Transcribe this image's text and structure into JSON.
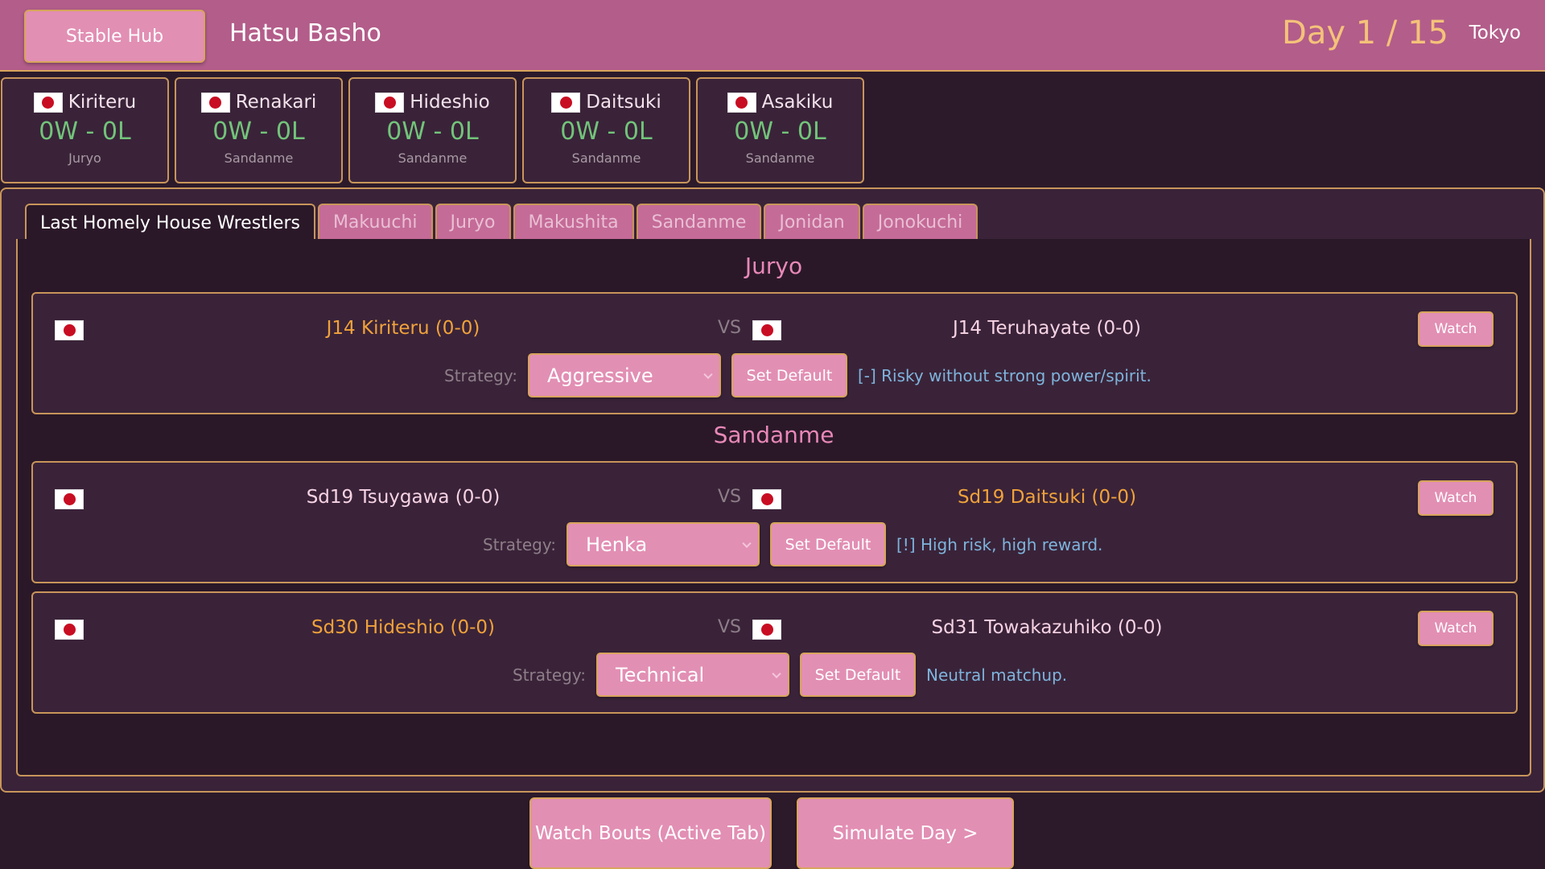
{
  "header": {
    "stable_hub_label": "Stable Hub",
    "basho_name": "Hatsu Basho",
    "day": "Day 1 / 15",
    "location": "Tokyo"
  },
  "wrestlers": [
    {
      "name": "Kiriteru",
      "record": "0W - 0L",
      "division": "Juryo"
    },
    {
      "name": "Renakari",
      "record": "0W - 0L",
      "division": "Sandanme"
    },
    {
      "name": "Hideshio",
      "record": "0W - 0L",
      "division": "Sandanme"
    },
    {
      "name": "Daitsuki",
      "record": "0W - 0L",
      "division": "Sandanme"
    },
    {
      "name": "Asakiku",
      "record": "0W - 0L",
      "division": "Sandanme"
    }
  ],
  "tabs": [
    {
      "label": "Last Homely House Wrestlers",
      "active": true
    },
    {
      "label": "Makuuchi"
    },
    {
      "label": "Juryo"
    },
    {
      "label": "Makushita"
    },
    {
      "label": "Sandanme"
    },
    {
      "label": "Jonidan"
    },
    {
      "label": "Jonokuchi"
    }
  ],
  "sections": [
    {
      "heading": "Juryo",
      "bouts": [
        {
          "east": "J14 Kiriteru (0-0)",
          "vs": "VS",
          "west": "J14 Teruhayate (0-0)",
          "watch_label": "Watch",
          "strategy_label": "Strategy:",
          "strategy_value": "Aggressive",
          "set_default_label": "Set Default",
          "hint": "[-] Risky without strong power/spirit."
        }
      ]
    },
    {
      "heading": "Sandanme",
      "bouts": [
        {
          "east": "Sd19 Tsuygawa (0-0)",
          "vs": "VS",
          "west": "Sd19 Daitsuki (0-0)",
          "watch_label": "Watch",
          "strategy_label": "Strategy:",
          "strategy_value": "Henka",
          "set_default_label": "Set Default",
          "hint": "[!] High risk, high reward."
        },
        {
          "east": "Sd30 Hideshio (0-0)",
          "vs": "VS",
          "west": "Sd31 Towakazuhiko (0-0)",
          "watch_label": "Watch",
          "strategy_label": "Strategy:",
          "strategy_value": "Technical",
          "set_default_label": "Set Default",
          "hint": "Neutral matchup."
        }
      ]
    }
  ],
  "footer": {
    "watch_bouts_label": "Watch Bouts (Active Tab)",
    "simulate_label": "Simulate Day >"
  },
  "colors": {
    "header_bg": "#b35d8a",
    "button_bg": "#e28fb4",
    "border_gold": "#c8955a",
    "own_wrestler": "#f0a23a",
    "record_green": "#72c47a",
    "hint_blue": "#7eb4dc"
  }
}
